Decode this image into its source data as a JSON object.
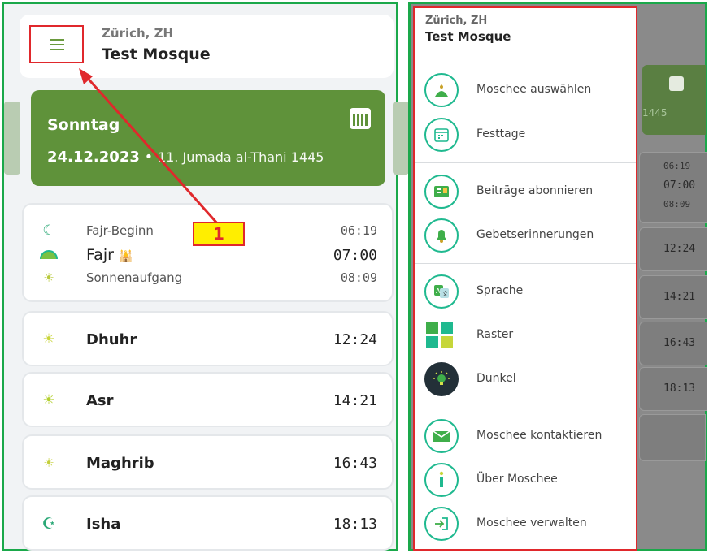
{
  "left": {
    "header": {
      "city": "Zürich, ZH",
      "mosque": "Test Mosque"
    },
    "date_card": {
      "day": "Sonntag",
      "date": "24.12.2023",
      "separator": " • ",
      "hijri": "11. Jumada al-Thani 1445"
    },
    "fajr_card": {
      "rows": [
        {
          "name": "Fajr-Beginn",
          "time": "06:19"
        },
        {
          "name": "Fajr",
          "time": "07:00"
        },
        {
          "name": "Sonnenaufgang",
          "time": "08:09"
        }
      ]
    },
    "prayers": [
      {
        "name": "Dhuhr",
        "time": "12:24"
      },
      {
        "name": "Asr",
        "time": "14:21"
      },
      {
        "name": "Maghrib",
        "time": "16:43"
      },
      {
        "name": "Isha",
        "time": "18:13"
      }
    ],
    "annotation": "1"
  },
  "drawer": {
    "city": "Zürich, ZH",
    "mosque": "Test Mosque",
    "items": [
      {
        "label": "Moschee auswählen",
        "icon": "mosque-icon"
      },
      {
        "label": "Festtage",
        "icon": "calendar-icon"
      },
      {
        "label": "Beiträge abonnieren",
        "icon": "news-icon"
      },
      {
        "label": "Gebetserinnerungen",
        "icon": "bell-icon"
      },
      {
        "label": "Sprache",
        "icon": "translate-icon"
      },
      {
        "label": "Raster",
        "icon": "grid-icon"
      },
      {
        "label": "Dunkel",
        "icon": "bulb-icon"
      },
      {
        "label": "Moschee kontaktieren",
        "icon": "mail-icon"
      },
      {
        "label": "Über Moschee",
        "icon": "info-icon"
      },
      {
        "label": "Moschee verwalten",
        "icon": "login-icon"
      }
    ]
  },
  "background_peek": {
    "date_partial": "1445",
    "times": [
      "06:19",
      "07:00",
      "08:09",
      "12:24",
      "14:21",
      "16:43",
      "18:13"
    ]
  },
  "colors": {
    "brand_green": "#5f923a",
    "accent_teal": "#1fb98f",
    "annotation_red": "#e0282c",
    "panel_border": "#1aa84a"
  }
}
